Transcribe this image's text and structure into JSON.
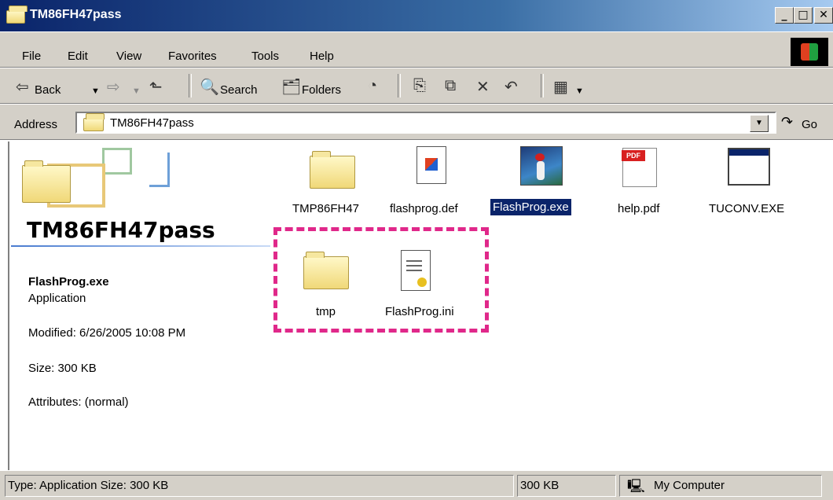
{
  "window": {
    "title": "TM86FH47pass"
  },
  "title_buttons": {
    "minimize": "_",
    "maximize": "□",
    "close": "✕"
  },
  "menu": [
    "File",
    "Edit",
    "View",
    "Favorites",
    "Tools",
    "Help"
  ],
  "toolbar": {
    "back": "Back",
    "search": "Search",
    "folders": "Folders"
  },
  "address": {
    "label": "Address",
    "value": "TM86FH47pass",
    "go": "Go"
  },
  "side_panel": {
    "folder_title": "TM86FH47pass",
    "selected_name": "FlashProg.exe",
    "selected_type": "Application",
    "modified": "Modified: 6/26/2005 10:08 PM",
    "size": "Size: 300 KB",
    "attributes": "Attributes: (normal)"
  },
  "files": [
    {
      "name": "TMP86FH47",
      "icon": "folder-icon"
    },
    {
      "name": "flashprog.def",
      "icon": "def-file-icon"
    },
    {
      "name": "FlashProg.exe",
      "icon": "woodpecker-app-icon",
      "selected": true
    },
    {
      "name": "help.pdf",
      "icon": "pdf-icon"
    },
    {
      "name": "TUCONV.EXE",
      "icon": "window-app-icon"
    },
    {
      "name": "tmp",
      "icon": "folder-icon"
    },
    {
      "name": "FlashProg.ini",
      "icon": "ini-file-icon"
    }
  ],
  "statusbar": {
    "text": "Type: Application Size: 300 KB",
    "size": "300 KB",
    "zone": "My Computer"
  },
  "colors": {
    "highlight": "#0a246a",
    "dash": "#e0288a",
    "face": "#d4d0c8"
  }
}
